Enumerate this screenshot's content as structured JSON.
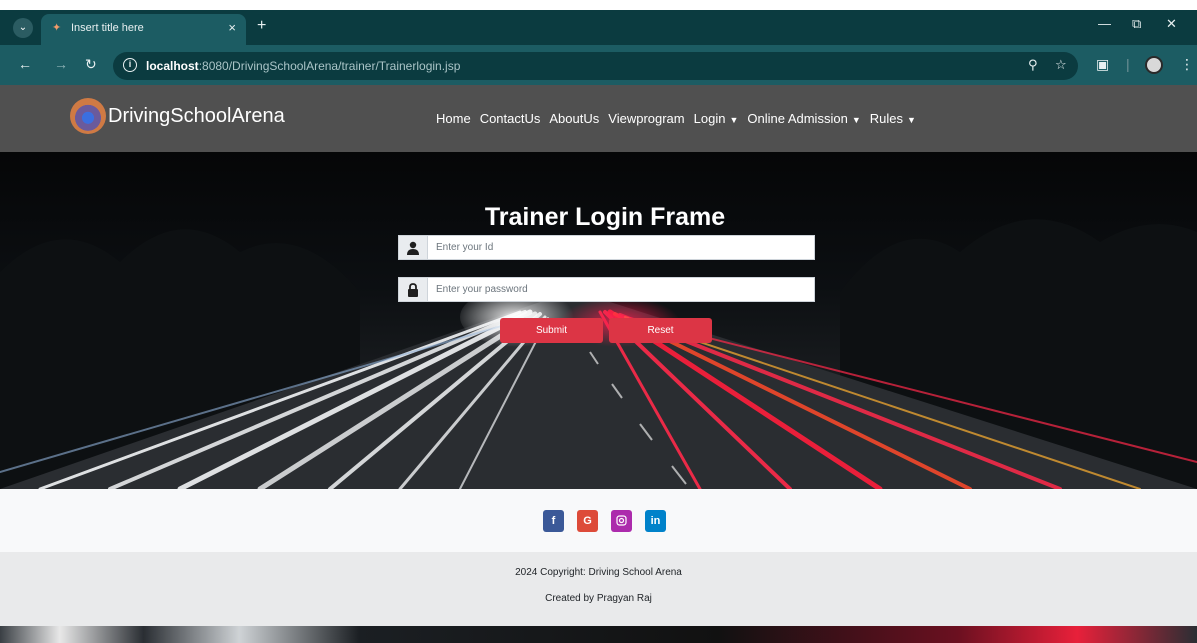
{
  "browser": {
    "tab_title": "Insert title here",
    "tab_close": "×",
    "new_tab": "+",
    "url_host": "localhost",
    "url_path": ":8080/DrivingSchoolArena/trainer/Trainerlogin.jsp"
  },
  "navbar": {
    "brand": "DrivingSchoolArena",
    "links": [
      "Home",
      "ContactUs",
      "AboutUs",
      "Viewprogram"
    ],
    "dropdowns": [
      "Login",
      "Online Admission",
      "Rules"
    ]
  },
  "form": {
    "title": "Trainer Login Frame",
    "id_placeholder": "Enter your Id",
    "password_placeholder": "Enter your password",
    "submit_label": "Submit",
    "reset_label": "Reset"
  },
  "footer": {
    "social": [
      "f",
      "G",
      "in"
    ],
    "copyright": "2024 Copyright: Driving School Arena",
    "credit": "Created by Pragyan Raj"
  },
  "colors": {
    "chrome_dark": "#0b3b40",
    "chrome_light": "#1c5c63",
    "navbar": "#505050",
    "button_red": "#dc3545",
    "facebook": "#3b5998",
    "google": "#dd4b39",
    "instagram": "#ac2bac",
    "linkedin": "#0082ca"
  }
}
